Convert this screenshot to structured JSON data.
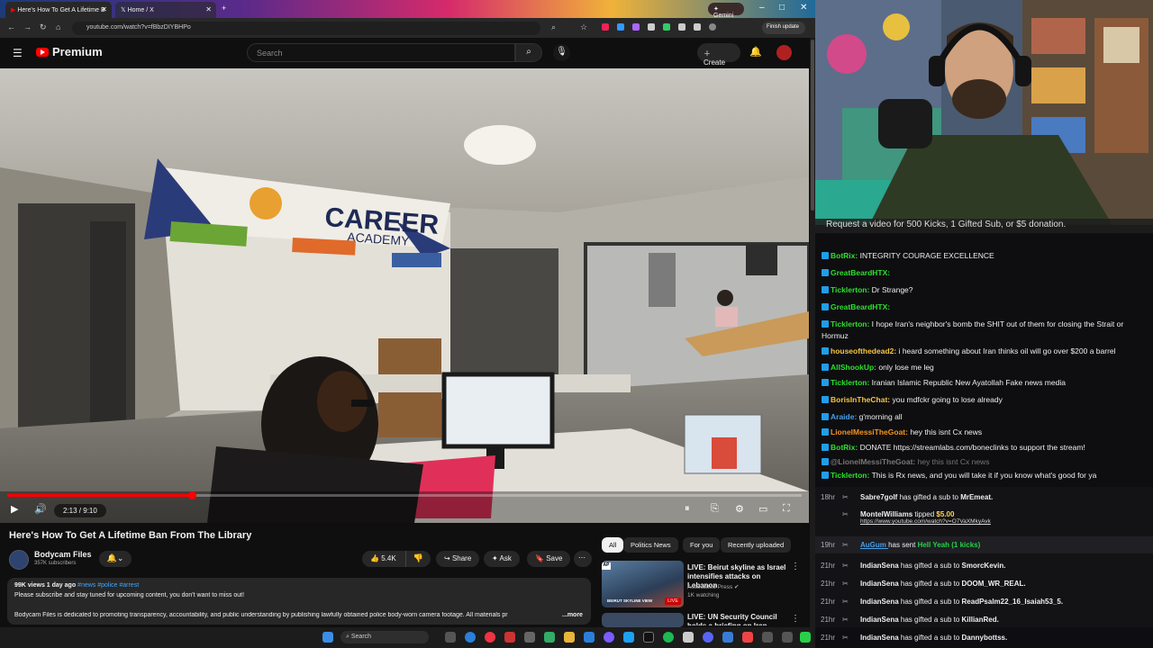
{
  "browser": {
    "tabs": [
      {
        "label": "Here's How To Get A Lifetime B"
      },
      {
        "label": "Home / X"
      }
    ],
    "gemini_label": "Gemini",
    "url": "youtube.com/watch?v=fBbzDIYBHPo",
    "finish_update": "Finish update"
  },
  "youtube": {
    "brand": "Premium",
    "search_placeholder": "Search",
    "create_label": "Create",
    "player": {
      "time": "2:13 / 9:10",
      "progress_fraction": 0.232
    },
    "video_title": "Here's How To Get A Lifetime Ban From The Library",
    "channel": {
      "name": "Bodycam Files",
      "subscribers": "357K subscribers"
    },
    "actions": {
      "likes": "5.4K",
      "share": "Share",
      "ask": "Ask",
      "save": "Save"
    },
    "description": {
      "meta": "99K views  1 day ago",
      "tags": "#news #police #arrest",
      "line1": "Please subscribe and stay tuned for upcoming content, you don't want to miss out!",
      "line2": "Bodycam Files is dedicated to promoting transparency, accountability, and public understanding by publishing lawfully obtained police body-worn camera footage. All materials pr",
      "more": "...more"
    },
    "chips": [
      "All",
      "Politics News",
      "For you",
      "Recently uploaded"
    ],
    "recommendations": [
      {
        "title": "LIVE: Beirut skyline as Israel intensifies attacks on Lebanon",
        "channel": "Associated Press",
        "meta": "1K watching",
        "badge": "LIVE",
        "thumb_text": "BEIRUT SKYLINE VIEW"
      },
      {
        "title": "LIVE: UN Security Council holds a briefing on Iran",
        "channel": "",
        "meta": "",
        "badge": "",
        "thumb_text": ""
      }
    ]
  },
  "stream": {
    "banner": "Request a video for 500 Kicks, 1 Gifted Sub, or $5 donation."
  },
  "chat": {
    "messages": [
      {
        "user": "BotRix",
        "color": "#2de02d",
        "text": "INTEGRITY COURAGE EXCELLENCE"
      },
      {
        "user": "GreatBeardHTX",
        "color": "#2de02d",
        "text": ""
      },
      {
        "user": "Ticklerton",
        "color": "#2de02d",
        "text": "Dr Strange?"
      },
      {
        "user": "GreatBeardHTX",
        "color": "#2de02d",
        "text": ""
      },
      {
        "user": "Ticklerton",
        "color": "#2de02d",
        "text": "I hope Iran's neighbor's bomb the SHIT out of them for closing the Strait or"
      },
      {
        "user": "",
        "color": "#efeff1",
        "text": "Hormuz"
      },
      {
        "user": "houseofthedead2",
        "color": "#f5c542",
        "text": "i heard something about Iran thinks oil will go over $200 a barrel"
      },
      {
        "user": "AllShookUp",
        "color": "#2de02d",
        "text": "only lose me leg"
      },
      {
        "user": "Ticklerton",
        "color": "#2de02d",
        "text": "Iranian Islamic Republic  New Ayatollah  Fake news media"
      },
      {
        "user": "BorisInTheChat",
        "color": "#f5c542",
        "text": "you mdfckr going to lose already"
      },
      {
        "user": "Araide",
        "color": "#4a9ee6",
        "text": "g'morning all"
      },
      {
        "user": "LionelMessiTheGoat",
        "color": "#f29322",
        "text": "hey this isnt Cx news"
      },
      {
        "user": "BotRix",
        "color": "#2de02d",
        "text": "DONATE https://streamlabs.com/boneclinks to support the stream!"
      },
      {
        "user": "@LionelMessiTheGoat",
        "color": "#777",
        "text": "hey this isnt Cx news"
      },
      {
        "user": "Ticklerton",
        "color": "#2de02d",
        "text": "This is Rx news, and you will take it if you know what's good for ya"
      }
    ],
    "events": [
      {
        "time": "18hr",
        "user": "Sabre7golf",
        "action": "has gifted a sub to",
        "target": "MrEmeat."
      },
      {
        "time": "",
        "user": "MontelWilliams",
        "action": "tipped",
        "target": "$5.00",
        "sub": "https://www.youtube.com/watch?v=O7VaXMkyAvk"
      },
      {
        "time": "19hr",
        "user": "AuGum",
        "action": "has sent",
        "target": "Hell Yeah (1 kicks)"
      },
      {
        "time": "21hr",
        "user": "IndianSena",
        "action": "has gifted a sub to",
        "target": "SmorcKevin."
      },
      {
        "time": "21hr",
        "user": "IndianSena",
        "action": "has gifted a sub to",
        "target": "DOOM_WR_REAL."
      },
      {
        "time": "21hr",
        "user": "IndianSena",
        "action": "has gifted a sub to",
        "target": "ReadPsalm22_16_Isaiah53_5."
      },
      {
        "time": "21hr",
        "user": "IndianSena",
        "action": "has gifted a sub to",
        "target": "KillianRed."
      },
      {
        "time": "21hr",
        "user": "IndianSena",
        "action": "has gifted a sub to",
        "target": "Dannybottss."
      }
    ]
  },
  "taskbar": {
    "search_label": "Search"
  }
}
